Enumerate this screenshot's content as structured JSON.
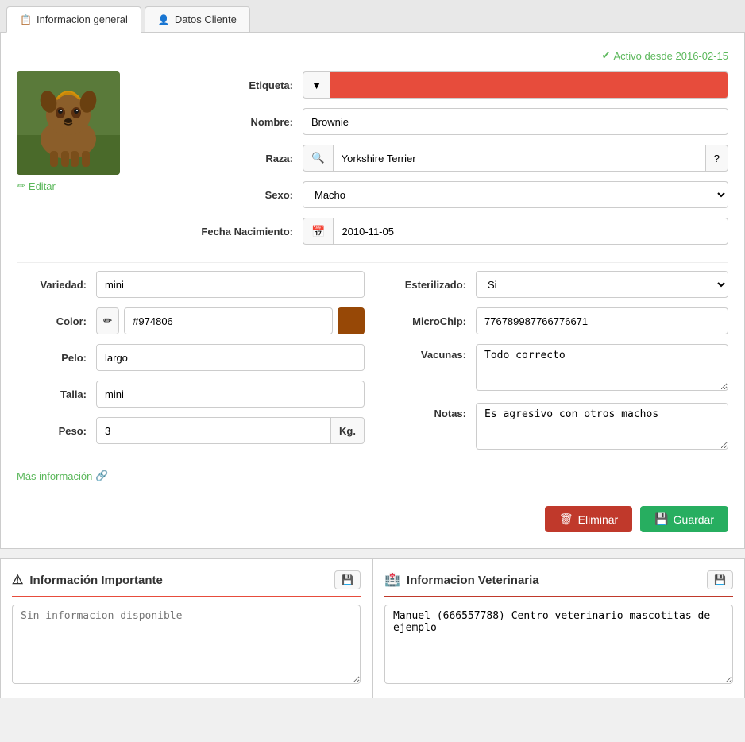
{
  "tabs": [
    {
      "id": "info-general",
      "label": "Informacion general",
      "icon": "📋",
      "active": true
    },
    {
      "id": "datos-cliente",
      "label": "Datos Cliente",
      "icon": "👤",
      "active": false
    }
  ],
  "status": {
    "active_label": "Activo desde 2016-02-15",
    "check_icon": "✔"
  },
  "photo": {
    "edit_label": "Editar",
    "edit_icon": "✏️"
  },
  "fields": {
    "etiqueta_label": "Etiqueta:",
    "etiqueta_color": "#e74c3c",
    "nombre_label": "Nombre:",
    "nombre_value": "Brownie",
    "raza_label": "Raza:",
    "raza_value": "Yorkshire Terrier",
    "sexo_label": "Sexo:",
    "sexo_value": "Macho",
    "fecha_label": "Fecha Nacimiento:",
    "fecha_value": "2010-11-05"
  },
  "bottom_left": {
    "variedad_label": "Variedad:",
    "variedad_value": "mini",
    "color_label": "Color:",
    "color_hex": "#974806",
    "color_swatch": "#974806",
    "pelo_label": "Pelo:",
    "pelo_value": "largo",
    "talla_label": "Talla:",
    "talla_value": "mini",
    "peso_label": "Peso:",
    "peso_value": "3",
    "peso_unit": "Kg."
  },
  "bottom_right": {
    "esterilizado_label": "Esterilizado:",
    "esterilizado_value": "Si",
    "microchip_label": "MicroChip:",
    "microchip_value": "776789987766776671",
    "vacunas_label": "Vacunas:",
    "vacunas_value": "Todo correcto",
    "notas_label": "Notas:",
    "notas_value": "Es agresivo con otros machos"
  },
  "mas_info": {
    "label": "Más información",
    "icon": "🔗"
  },
  "actions": {
    "eliminar_label": "Eliminar",
    "guardar_label": "Guardar",
    "trash_icon": "🗑",
    "save_icon": "💾"
  },
  "panel_importante": {
    "title": "Información Importante",
    "icon": "⚠",
    "placeholder": "Sin informacion disponible",
    "value": ""
  },
  "panel_veterinaria": {
    "title": "Informacion Veterinaria",
    "icon": "🏥",
    "placeholder": "",
    "value": "Manuel (666557788) Centro veterinario mascotitas de ejemplo"
  }
}
